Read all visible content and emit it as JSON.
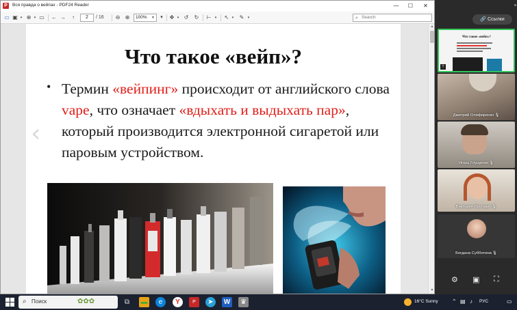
{
  "window": {
    "title": "Вся правда о вейпах - PDF24 Reader",
    "app_icon": "P",
    "minimize": "—",
    "maximize": "☐",
    "close": "✕"
  },
  "toolbar": {
    "page_current": "2",
    "page_total": "/ 16",
    "zoom": "100%",
    "search_placeholder": "Search"
  },
  "slide": {
    "title": "Что такое «вейп»?",
    "bullet": "•",
    "text_1": "Термин ",
    "text_2": "«вейпинг»",
    "text_3": " происходит от английского слова ",
    "text_4": "vape",
    "text_5": ", что означает ",
    "text_6": "«вдыхать и выдыхать пар»",
    "text_7": ", который производится электронной сигаретой или паровым устройством."
  },
  "conference": {
    "links_label": "Ссылки",
    "participants": [
      {
        "name": "Дмитрий Олифиренко"
      },
      {
        "name": "Игорь Глущенко"
      },
      {
        "name": "Виктория Пустовит"
      },
      {
        "name": "Богдана Субботина"
      }
    ],
    "thumb_title": "Что такое «вейп»?"
  },
  "taskbar": {
    "search_placeholder": "Поиск",
    "weather": "16°C  Sunny",
    "lang": "РУС"
  }
}
